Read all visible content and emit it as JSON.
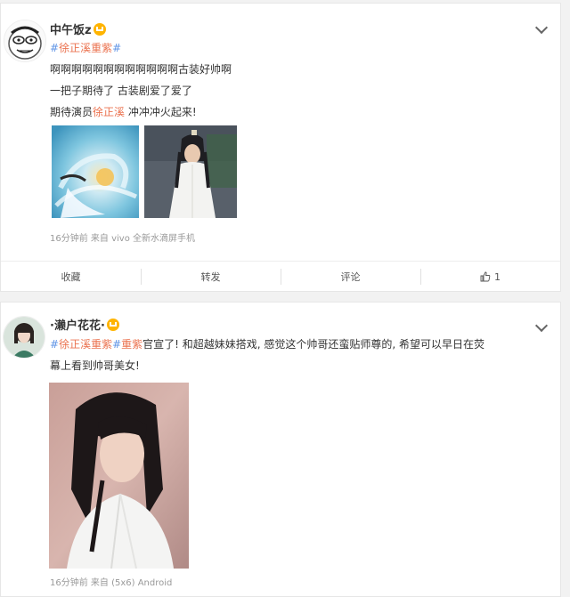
{
  "post1": {
    "username": "中午饭z",
    "text_line1_hash1": "#",
    "text_line1_tag": "徐正溪重紫",
    "text_line1_hash2": "#",
    "text_line2": "啊啊啊啊啊啊啊啊啊啊啊啊古装好帅啊",
    "text_line3": "一把子期待了 古装剧爱了爱了",
    "text_line4_a": "期待演员",
    "text_line4_tag": "徐正溪",
    "text_line4_b": " 冲冲冲火起来!",
    "meta": "16分钟前  来自 vivo 全新水滴屏手机",
    "actions": {
      "favorite": "收藏",
      "repost": "转发",
      "comment": "评论",
      "like_count": "1"
    }
  },
  "post2": {
    "username": "·濑户花花·",
    "text_l1_h1": "#",
    "text_l1_t1": "徐正溪重紫",
    "text_l1_h2": "#",
    "text_l1_t2": "重紫",
    "text_l1_rest": "官宣了!  和超越妹妹搭戏, 感觉这个帅哥还蛮贴师尊的, 希望可以早日在荧",
    "text_l2": "幕上看到帅哥美女!",
    "meta_partial": "16分钟前  来自  (5x6)  Android"
  },
  "colors": {
    "tag": "#eb7350",
    "hash": "#5e93e5",
    "crown": "#ffb400"
  },
  "icons": [
    "chevron-down-icon",
    "crown-icon",
    "thumbs-up-icon"
  ]
}
